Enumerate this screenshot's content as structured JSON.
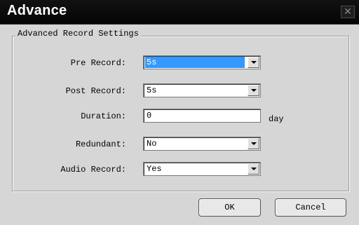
{
  "window": {
    "title": "Advance",
    "close_symbol": "✕",
    "close_icon": "close-icon"
  },
  "group": {
    "title": "Advanced Record Settings"
  },
  "fields": {
    "pre_record": {
      "label": "Pre Record:",
      "value": "5s",
      "selected": true
    },
    "post_record": {
      "label": "Post Record:",
      "value": "5s"
    },
    "duration": {
      "label": "Duration:",
      "value": "0",
      "unit": "day"
    },
    "redundant": {
      "label": "Redundant:",
      "value": "No"
    },
    "audio_record": {
      "label": "Audio Record:",
      "value": "Yes"
    }
  },
  "buttons": {
    "ok": "OK",
    "cancel": "Cancel"
  },
  "colors": {
    "titlebar": "#0a0a0a",
    "selection": "#3399ff",
    "dialog_bg": "#d6d6d6"
  }
}
